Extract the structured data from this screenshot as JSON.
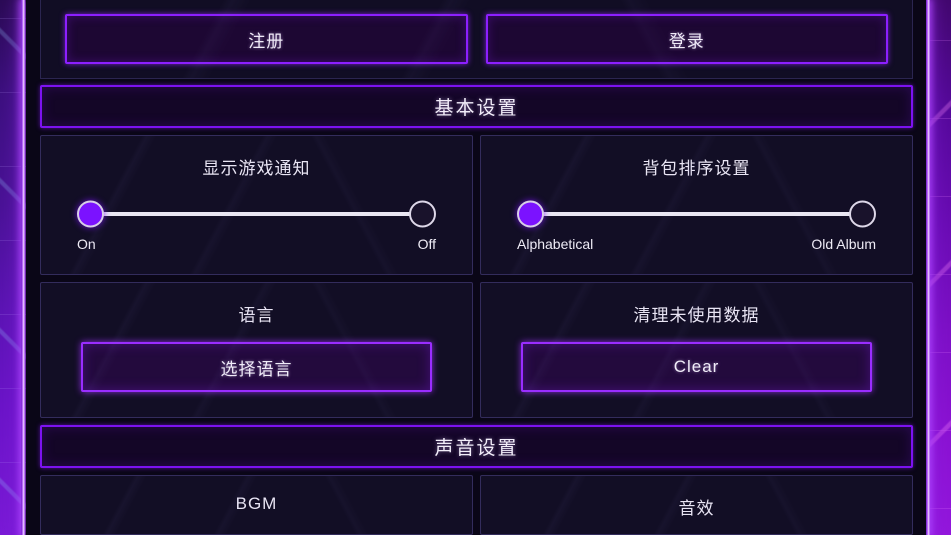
{
  "theme": {
    "background": "#0a0617",
    "panel_bg": "#120e25",
    "accent": "#7b12ff",
    "accent_bright": "#9a2dff",
    "border_dim": "#332c5c",
    "text": "#efecf6"
  },
  "auth": {
    "register_label": "注册",
    "login_label": "登录"
  },
  "sections": [
    {
      "title": "基本设置"
    },
    {
      "title": "声音设置"
    }
  ],
  "basic_settings": {
    "notification": {
      "title": "显示游戏通知",
      "left_label": "On",
      "right_label": "Off",
      "selected": "On"
    },
    "bag_sort": {
      "title": "背包排序设置",
      "left_label": "Alphabetical",
      "right_label": "Old Album",
      "selected": "Alphabetical"
    },
    "language": {
      "title": "语言",
      "button_label": "选择语言"
    },
    "clear_data": {
      "title": "清理未使用数据",
      "button_label": "Clear"
    }
  },
  "sound_settings": {
    "bgm": {
      "title": "BGM"
    },
    "sfx": {
      "title": "音效"
    }
  }
}
